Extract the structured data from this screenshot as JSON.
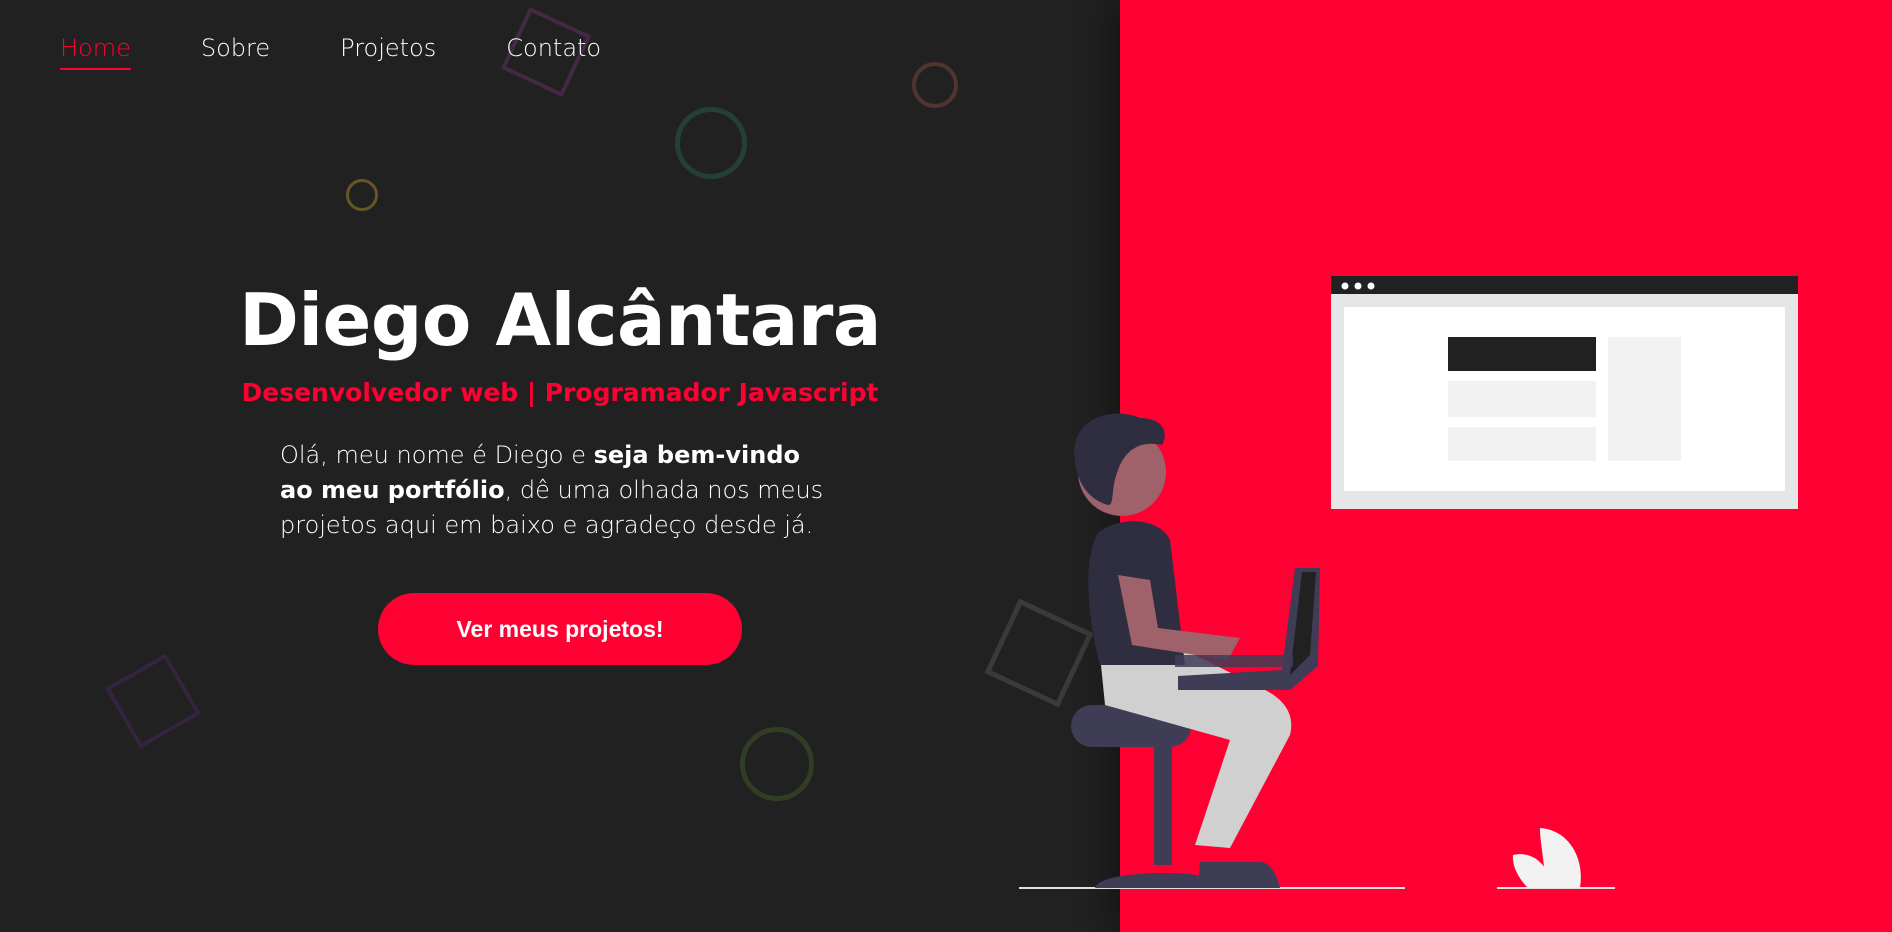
{
  "nav": {
    "items": [
      {
        "label": "Home",
        "active": true
      },
      {
        "label": "Sobre",
        "active": false
      },
      {
        "label": "Projetos",
        "active": false
      },
      {
        "label": "Contato",
        "active": false
      }
    ]
  },
  "hero": {
    "name": "Diego Alcântara",
    "subtitle": "Desenvolvedor web | Programador Javascript",
    "text_part1": "Olá, meu nome é Diego e ",
    "text_bold": "seja bem-vindo ao meu portfólio",
    "text_part2": ", dê uma olhada nos meus projetos aqui em baixo e agradeço desde já.",
    "cta_label": "Ver meus projetos!"
  },
  "colors": {
    "background": "#212121",
    "accent": "#ff0033",
    "text": "#ffffff"
  },
  "icons": {
    "illustration": "person-with-laptop-on-stool",
    "browser_window": "browser-window-mockup"
  }
}
